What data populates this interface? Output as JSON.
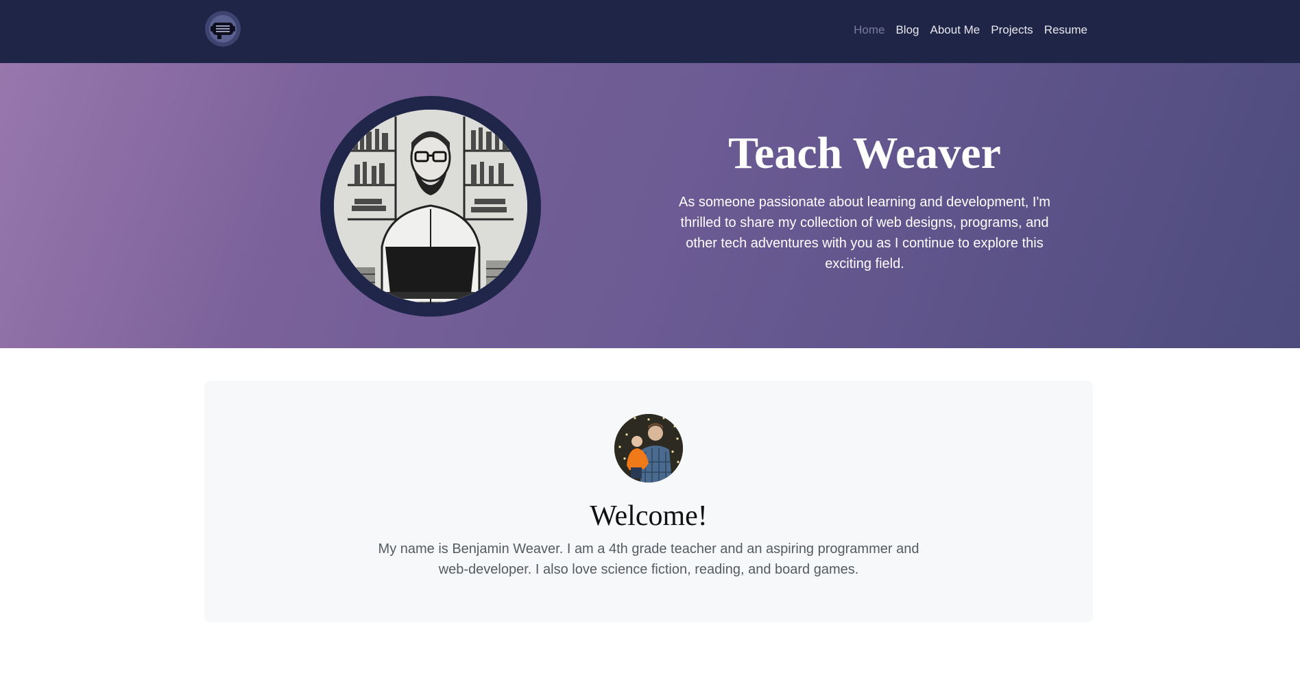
{
  "nav": {
    "logo_icon": "chat-bubble-logo-icon",
    "links": [
      {
        "label": "Home",
        "active": true
      },
      {
        "label": "Blog",
        "active": false
      },
      {
        "label": "About Me",
        "active": false
      },
      {
        "label": "Projects",
        "active": false
      },
      {
        "label": "Resume",
        "active": false
      }
    ]
  },
  "hero": {
    "title": "Teach Weaver",
    "subtitle": "As someone passionate about learning and development, I'm thrilled to share my collection of web designs, programs, and other tech adventures with you as I continue to explore this exciting field.",
    "image": "illustration-man-at-laptop"
  },
  "welcome": {
    "avatar": "profile-photo",
    "title": "Welcome!",
    "text": "My name is Benjamin Weaver. I am a 4th grade teacher and an aspiring programmer and web-developer. I also love science fiction, reading, and board games."
  },
  "colors": {
    "navbar": "#1f2547",
    "hero_gradient_start": "#9877ad",
    "hero_gradient_end": "#4d4b7e",
    "card_bg": "#f7f8f9",
    "nav_active": "#7a7d9c"
  }
}
